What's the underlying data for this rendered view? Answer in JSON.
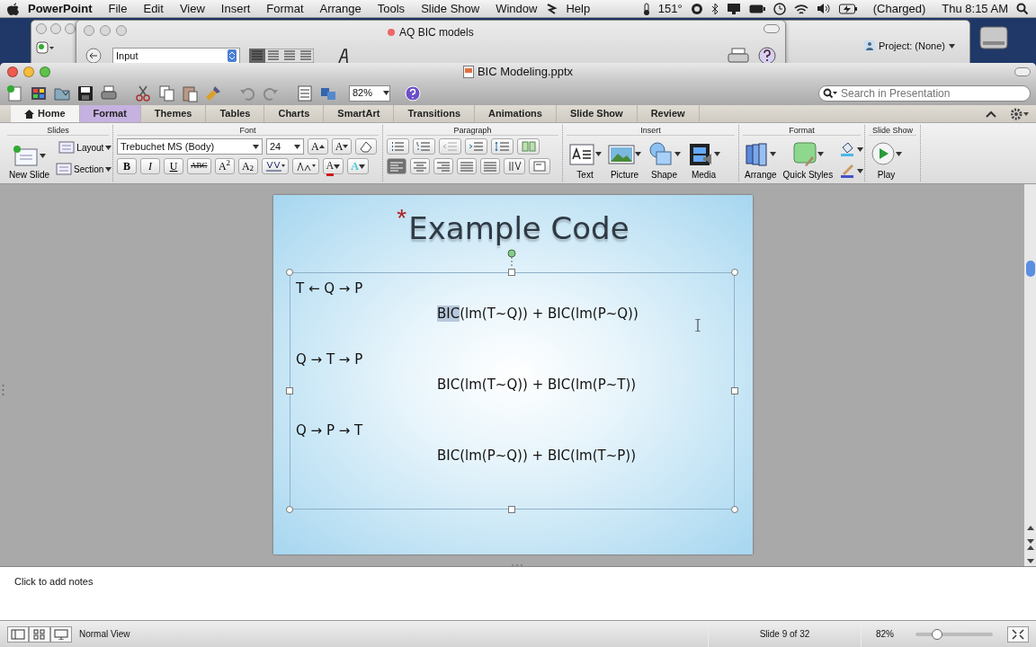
{
  "menubar": {
    "app": "PowerPoint",
    "menus": [
      "File",
      "Edit",
      "View",
      "Insert",
      "Format",
      "Arrange",
      "Tools",
      "Slide Show",
      "Window",
      "Help"
    ],
    "temperature": "151°",
    "battery": "(Charged)",
    "clock": "Thu 8:15 AM"
  },
  "back_windows": [
    {
      "kind": "document",
      "title": "AQ BIC models",
      "style": "Input"
    },
    {
      "kind": "project",
      "label": "Project: (None)"
    }
  ],
  "window": {
    "title": "BIC Modeling.pptx"
  },
  "toolbar": {
    "zoom": "82%",
    "search": {
      "placeholder": "Search in Presentation"
    }
  },
  "ribbon_tabs": [
    {
      "label": "Home",
      "selected": true,
      "contextual": false
    },
    {
      "label": "Format",
      "selected": false,
      "contextual": true
    },
    {
      "label": "Themes",
      "selected": false,
      "contextual": false
    },
    {
      "label": "Tables",
      "selected": false,
      "contextual": false
    },
    {
      "label": "Charts",
      "selected": false,
      "contextual": false
    },
    {
      "label": "SmartArt",
      "selected": false,
      "contextual": false
    },
    {
      "label": "Transitions",
      "selected": false,
      "contextual": false
    },
    {
      "label": "Animations",
      "selected": false,
      "contextual": false
    },
    {
      "label": "Slide Show",
      "selected": false,
      "contextual": false
    },
    {
      "label": "Review",
      "selected": false,
      "contextual": false
    }
  ],
  "ribbon": {
    "slides": {
      "title": "Slides",
      "new_slide": "New Slide",
      "layout": "Layout",
      "section": "Section"
    },
    "font": {
      "title": "Font",
      "name": "Trebuchet MS (Body)",
      "size": "24",
      "styles": [
        "B",
        "I",
        "U",
        "ABC",
        "A$^{2}$",
        "A$_{2}$"
      ],
      "size_buttons": [
        {
          "label": "A",
          "kind": "grow"
        },
        {
          "label": "A",
          "kind": "shrink"
        }
      ],
      "color_buttons": [
        {
          "label": "A",
          "color": "#d01818"
        },
        {
          "label": "A",
          "color": "#48c8d8"
        }
      ]
    },
    "paragraph": {
      "title": "Paragraph",
      "alignment": [
        {
          "kind": "left",
          "selected": true
        },
        {
          "kind": "center",
          "selected": false
        },
        {
          "kind": "right",
          "selected": false
        },
        {
          "kind": "justify",
          "selected": false
        },
        {
          "kind": "distributed",
          "selected": false
        }
      ]
    },
    "insert": {
      "title": "Insert",
      "items": [
        {
          "kind": "text",
          "label": "Text"
        },
        {
          "kind": "picture",
          "label": "Picture"
        },
        {
          "kind": "shape",
          "label": "Shape"
        },
        {
          "kind": "media",
          "label": "Media"
        }
      ]
    },
    "format": {
      "title": "Format",
      "items": [
        {
          "kind": "arrange",
          "label": "Arrange"
        },
        {
          "kind": "styles",
          "label": "Quick Styles"
        }
      ]
    },
    "slide_show": {
      "title": "Slide Show",
      "play": "Play"
    }
  },
  "slide": {
    "title_mark": "*",
    "title": "Example Code",
    "rows": [
      {
        "path": "T ← Q → P",
        "formula": [
          {
            "text": "BIC",
            "selected": true
          },
          {
            "text": "(lm(T~Q)) + BIC(lm(P~Q))",
            "selected": false
          }
        ]
      },
      {
        "path": "Q → T → P",
        "formula": [
          {
            "text": "BIC(lm(T~Q)) + BIC(lm(P~T))",
            "selected": false
          }
        ]
      },
      {
        "path": "Q → P → T",
        "formula": [
          {
            "text": "BIC(lm(P~Q)) + BIC(lm(T~P))",
            "selected": false
          }
        ]
      }
    ]
  },
  "notes": {
    "placeholder": "Click to add notes"
  },
  "status_bar": {
    "view": "Normal View",
    "slide": "Slide 9 of 32",
    "zoom": "82%",
    "zoom_slider": {
      "level": 0.28
    }
  }
}
